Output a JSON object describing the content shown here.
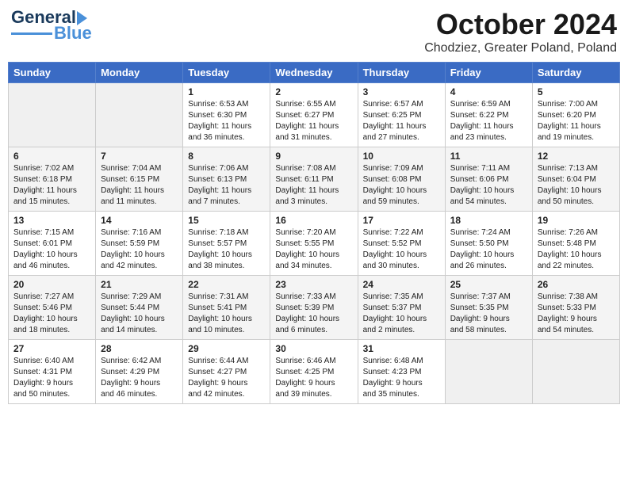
{
  "header": {
    "logo_line1": "General",
    "logo_line2": "Blue",
    "month": "October 2024",
    "location": "Chodziez, Greater Poland, Poland"
  },
  "days_of_week": [
    "Sunday",
    "Monday",
    "Tuesday",
    "Wednesday",
    "Thursday",
    "Friday",
    "Saturday"
  ],
  "weeks": [
    [
      {
        "num": "",
        "info": ""
      },
      {
        "num": "",
        "info": ""
      },
      {
        "num": "1",
        "info": "Sunrise: 6:53 AM\nSunset: 6:30 PM\nDaylight: 11 hours\nand 36 minutes."
      },
      {
        "num": "2",
        "info": "Sunrise: 6:55 AM\nSunset: 6:27 PM\nDaylight: 11 hours\nand 31 minutes."
      },
      {
        "num": "3",
        "info": "Sunrise: 6:57 AM\nSunset: 6:25 PM\nDaylight: 11 hours\nand 27 minutes."
      },
      {
        "num": "4",
        "info": "Sunrise: 6:59 AM\nSunset: 6:22 PM\nDaylight: 11 hours\nand 23 minutes."
      },
      {
        "num": "5",
        "info": "Sunrise: 7:00 AM\nSunset: 6:20 PM\nDaylight: 11 hours\nand 19 minutes."
      }
    ],
    [
      {
        "num": "6",
        "info": "Sunrise: 7:02 AM\nSunset: 6:18 PM\nDaylight: 11 hours\nand 15 minutes."
      },
      {
        "num": "7",
        "info": "Sunrise: 7:04 AM\nSunset: 6:15 PM\nDaylight: 11 hours\nand 11 minutes."
      },
      {
        "num": "8",
        "info": "Sunrise: 7:06 AM\nSunset: 6:13 PM\nDaylight: 11 hours\nand 7 minutes."
      },
      {
        "num": "9",
        "info": "Sunrise: 7:08 AM\nSunset: 6:11 PM\nDaylight: 11 hours\nand 3 minutes."
      },
      {
        "num": "10",
        "info": "Sunrise: 7:09 AM\nSunset: 6:08 PM\nDaylight: 10 hours\nand 59 minutes."
      },
      {
        "num": "11",
        "info": "Sunrise: 7:11 AM\nSunset: 6:06 PM\nDaylight: 10 hours\nand 54 minutes."
      },
      {
        "num": "12",
        "info": "Sunrise: 7:13 AM\nSunset: 6:04 PM\nDaylight: 10 hours\nand 50 minutes."
      }
    ],
    [
      {
        "num": "13",
        "info": "Sunrise: 7:15 AM\nSunset: 6:01 PM\nDaylight: 10 hours\nand 46 minutes."
      },
      {
        "num": "14",
        "info": "Sunrise: 7:16 AM\nSunset: 5:59 PM\nDaylight: 10 hours\nand 42 minutes."
      },
      {
        "num": "15",
        "info": "Sunrise: 7:18 AM\nSunset: 5:57 PM\nDaylight: 10 hours\nand 38 minutes."
      },
      {
        "num": "16",
        "info": "Sunrise: 7:20 AM\nSunset: 5:55 PM\nDaylight: 10 hours\nand 34 minutes."
      },
      {
        "num": "17",
        "info": "Sunrise: 7:22 AM\nSunset: 5:52 PM\nDaylight: 10 hours\nand 30 minutes."
      },
      {
        "num": "18",
        "info": "Sunrise: 7:24 AM\nSunset: 5:50 PM\nDaylight: 10 hours\nand 26 minutes."
      },
      {
        "num": "19",
        "info": "Sunrise: 7:26 AM\nSunset: 5:48 PM\nDaylight: 10 hours\nand 22 minutes."
      }
    ],
    [
      {
        "num": "20",
        "info": "Sunrise: 7:27 AM\nSunset: 5:46 PM\nDaylight: 10 hours\nand 18 minutes."
      },
      {
        "num": "21",
        "info": "Sunrise: 7:29 AM\nSunset: 5:44 PM\nDaylight: 10 hours\nand 14 minutes."
      },
      {
        "num": "22",
        "info": "Sunrise: 7:31 AM\nSunset: 5:41 PM\nDaylight: 10 hours\nand 10 minutes."
      },
      {
        "num": "23",
        "info": "Sunrise: 7:33 AM\nSunset: 5:39 PM\nDaylight: 10 hours\nand 6 minutes."
      },
      {
        "num": "24",
        "info": "Sunrise: 7:35 AM\nSunset: 5:37 PM\nDaylight: 10 hours\nand 2 minutes."
      },
      {
        "num": "25",
        "info": "Sunrise: 7:37 AM\nSunset: 5:35 PM\nDaylight: 9 hours\nand 58 minutes."
      },
      {
        "num": "26",
        "info": "Sunrise: 7:38 AM\nSunset: 5:33 PM\nDaylight: 9 hours\nand 54 minutes."
      }
    ],
    [
      {
        "num": "27",
        "info": "Sunrise: 6:40 AM\nSunset: 4:31 PM\nDaylight: 9 hours\nand 50 minutes."
      },
      {
        "num": "28",
        "info": "Sunrise: 6:42 AM\nSunset: 4:29 PM\nDaylight: 9 hours\nand 46 minutes."
      },
      {
        "num": "29",
        "info": "Sunrise: 6:44 AM\nSunset: 4:27 PM\nDaylight: 9 hours\nand 42 minutes."
      },
      {
        "num": "30",
        "info": "Sunrise: 6:46 AM\nSunset: 4:25 PM\nDaylight: 9 hours\nand 39 minutes."
      },
      {
        "num": "31",
        "info": "Sunrise: 6:48 AM\nSunset: 4:23 PM\nDaylight: 9 hours\nand 35 minutes."
      },
      {
        "num": "",
        "info": ""
      },
      {
        "num": "",
        "info": ""
      }
    ]
  ]
}
